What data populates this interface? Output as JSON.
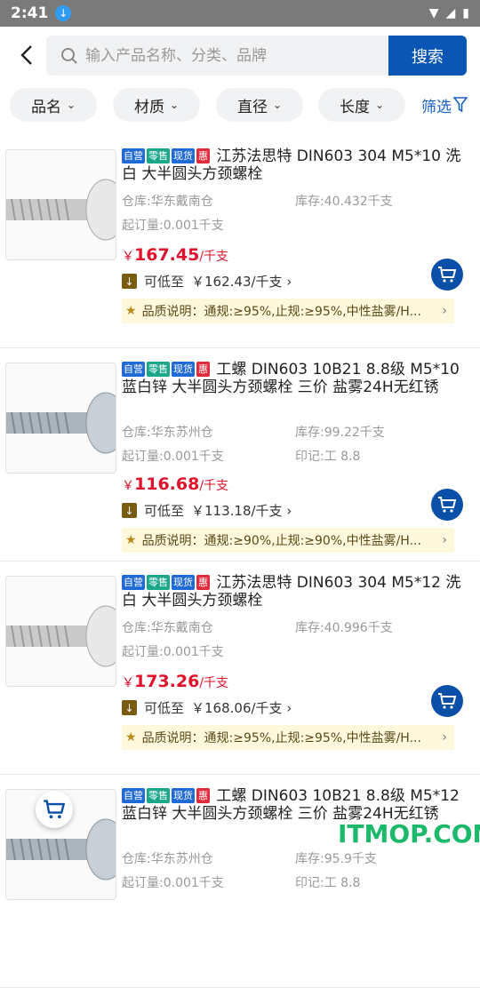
{
  "status_bar": {
    "time": "2:41"
  },
  "search": {
    "placeholder": "输入产品名称、分类、品牌",
    "button_label": "搜索"
  },
  "filters": {
    "chips": [
      "品名",
      "材质",
      "直径",
      "长度"
    ],
    "filter_link": "筛选"
  },
  "tags": {
    "self": "自营",
    "retail": "零售",
    "stock": "现货",
    "promo": "惠"
  },
  "items": [
    {
      "title": "江苏法思特  DIN603  304  M5*10  洗白  大半圆头方颈螺栓",
      "warehouse": "仓库:华东戴南仓",
      "stock": "库存:40.432千支",
      "moq": "起订量:0.001千支",
      "mark": "",
      "price_symbol": "￥",
      "price": "167.45",
      "unit": "/千支",
      "lower_label": "可低至",
      "lower_value": "￥162.43/千支 ›",
      "quality": "品质说明：通规:≥95%,止规:≥95%,中性盐雾/H..."
    },
    {
      "title": "工螺  DIN603  10B21  8.8级  M5*10  蓝白锌  大半圆头方颈螺栓  三价 盐雾24H无红锈",
      "warehouse": "仓库:华东苏州仓",
      "stock": "库存:99.22千支",
      "moq": "起订量:0.001千支",
      "mark": "印记:工 8.8",
      "price_symbol": "￥",
      "price": "116.68",
      "unit": "/千支",
      "lower_label": "可低至",
      "lower_value": "￥113.18/千支 ›",
      "quality": "品质说明：通规:≥90%,止规:≥90%,中性盐雾/H..."
    },
    {
      "title": "江苏法思特  DIN603  304  M5*12  洗白  大半圆头方颈螺栓",
      "warehouse": "仓库:华东戴南仓",
      "stock": "库存:40.996千支",
      "moq": "起订量:0.001千支",
      "mark": "",
      "price_symbol": "￥",
      "price": "173.26",
      "unit": "/千支",
      "lower_label": "可低至",
      "lower_value": "￥168.06/千支 ›",
      "quality": "品质说明：通规:≥95%,止规:≥95%,中性盐雾/H..."
    },
    {
      "title": "工螺  DIN603  10B21  8.8级  M5*12  蓝白锌  大半圆头方颈螺栓  三价 盐雾24H无红锈",
      "warehouse": "仓库:华东苏州仓",
      "stock": "库存:95.9千支",
      "moq": "起订量:0.001千支",
      "mark": "印记:工 8.8",
      "price_symbol": "",
      "price": "",
      "unit": "",
      "lower_label": "",
      "lower_value": "",
      "quality": ""
    }
  ],
  "watermark": "ITMOP.COM",
  "colors": {
    "brand_blue": "#0a56b4",
    "price_red": "#e0112a",
    "quality_bg": "#fff8dc"
  }
}
